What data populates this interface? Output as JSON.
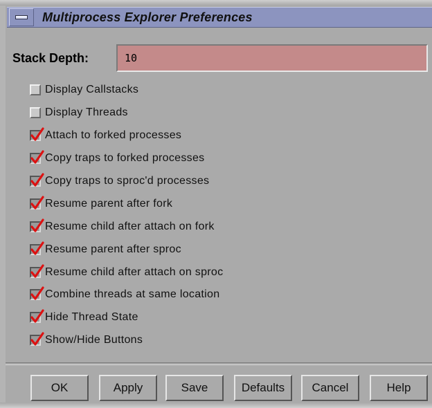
{
  "window": {
    "title": "Multiprocess Explorer Preferences",
    "menu_icon": "window-menu-icon"
  },
  "stack_depth": {
    "label": "Stack Depth:",
    "value": "10",
    "field_color": "#c48a8a"
  },
  "options": [
    {
      "label": "Display Callstacks",
      "checked": false
    },
    {
      "label": "Display Threads",
      "checked": false
    },
    {
      "label": "Attach to forked processes",
      "checked": true
    },
    {
      "label": "Copy traps to forked processes",
      "checked": true
    },
    {
      "label": "Copy traps to sproc'd processes",
      "checked": true
    },
    {
      "label": "Resume parent after fork",
      "checked": true
    },
    {
      "label": "Resume child after attach on fork",
      "checked": true
    },
    {
      "label": "Resume parent after sproc",
      "checked": true
    },
    {
      "label": "Resume child after attach on sproc",
      "checked": true
    },
    {
      "label": "Combine threads at same location",
      "checked": true
    },
    {
      "label": "Hide Thread State",
      "checked": true
    },
    {
      "label": "Show/Hide Buttons",
      "checked": true
    }
  ],
  "buttons": {
    "ok": "OK",
    "apply": "Apply",
    "save": "Save",
    "defaults": "Defaults",
    "cancel": "Cancel",
    "help": "Help"
  },
  "colors": {
    "titlebar": "#8c94bf",
    "panel": "#aaaaaa",
    "check_mark": "#dd1111"
  }
}
